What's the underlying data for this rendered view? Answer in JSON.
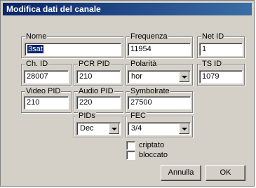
{
  "window": {
    "title": "Modifica dati del canale"
  },
  "fields": {
    "nome": {
      "label": "Nome",
      "value": "3sat"
    },
    "frequenza": {
      "label": "Frequenza",
      "value": "11954"
    },
    "net_id": {
      "label": "Net ID",
      "value": "1"
    },
    "ch_id": {
      "label": "Ch. ID",
      "value": "28007"
    },
    "pcr_pid": {
      "label": "PCR PID",
      "value": "210"
    },
    "polarita": {
      "label": "Polarità",
      "value": "hor"
    },
    "ts_id": {
      "label": "TS ID",
      "value": "1079"
    },
    "video_pid": {
      "label": "Video PID",
      "value": "210"
    },
    "audio_pid": {
      "label": "Audio PID",
      "value": "220"
    },
    "symbolrate": {
      "label": "Symbolrate",
      "value": "27500"
    },
    "pids": {
      "label": "PIDs",
      "value": "Dec"
    },
    "fec": {
      "label": "FEC",
      "value": "3/4"
    }
  },
  "checkboxes": {
    "criptato": {
      "label": "criptato",
      "checked": false
    },
    "bloccato": {
      "label": "bloccato",
      "checked": false
    }
  },
  "buttons": {
    "annulla": "Annulla",
    "ok": "OK"
  }
}
